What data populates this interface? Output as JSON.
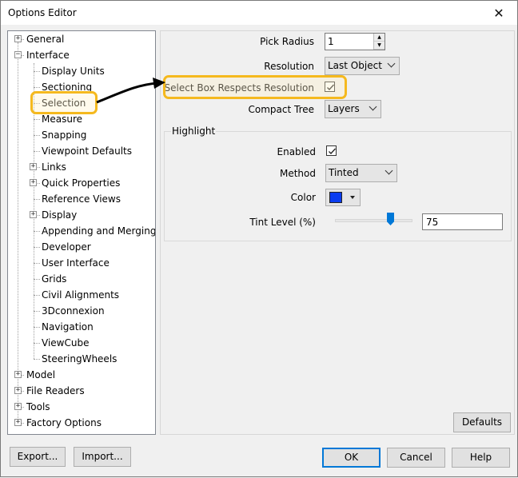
{
  "window": {
    "title": "Options Editor",
    "close_glyph": "✕"
  },
  "tree": {
    "general": "General",
    "interface": "Interface",
    "interface_children": {
      "display_units": "Display Units",
      "sectioning": "Sectioning",
      "selection": "Selection",
      "measure": "Measure",
      "snapping": "Snapping",
      "viewpoint_defaults": "Viewpoint Defaults",
      "links": "Links",
      "quick_properties": "Quick Properties",
      "reference_views": "Reference Views",
      "display": "Display",
      "appending_and_merging": "Appending and Merging",
      "developer": "Developer",
      "user_interface": "User Interface",
      "grids": "Grids",
      "civil_alignments": "Civil Alignments",
      "connexion": "3Dconnexion",
      "navigation": "Navigation",
      "viewcube": "ViewCube",
      "steeringwheels": "SteeringWheels"
    },
    "model": "Model",
    "file_readers": "File Readers",
    "tools": "Tools",
    "factory_options": "Factory Options",
    "selected_item": "Selection",
    "expand_glyph": "+",
    "collapse_glyph": "−"
  },
  "settings": {
    "pick_radius_label": "Pick Radius",
    "pick_radius_value": "1",
    "resolution_label": "Resolution",
    "resolution_value": "Last Object",
    "select_box_label": "Select Box Respects Resolution",
    "select_box_checked": true,
    "compact_tree_label": "Compact Tree",
    "compact_tree_value": "Layers"
  },
  "highlight": {
    "group_title": "Highlight",
    "enabled_label": "Enabled",
    "enabled_checked": true,
    "method_label": "Method",
    "method_value": "Tinted",
    "color_label": "Color",
    "color_value": "#0a3cf0",
    "tint_level_label": "Tint Level (%)",
    "tint_level_value": "75",
    "tint_level_slider_percent": 75
  },
  "buttons": {
    "defaults": "Defaults",
    "export": "Export...",
    "import": "Import...",
    "ok": "OK",
    "cancel": "Cancel",
    "help": "Help"
  },
  "annotation": {
    "highlight_color": "#f5b91e",
    "arrow_color": "#000000"
  }
}
